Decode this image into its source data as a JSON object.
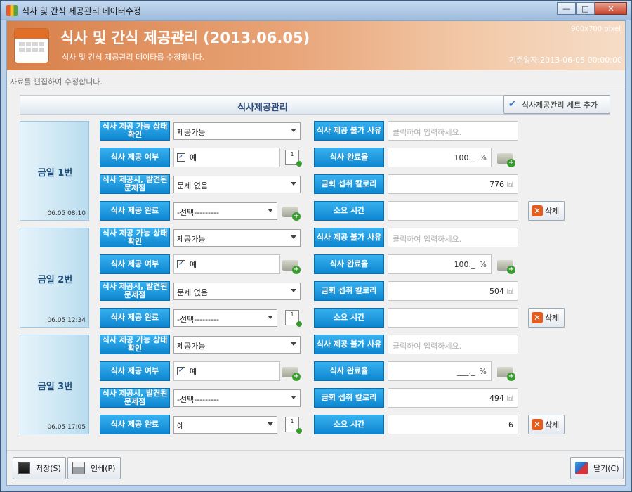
{
  "window": {
    "title": "식사 및 간식 제공관리 데이터수정",
    "controls": [
      "—",
      "□",
      "✕"
    ]
  },
  "header": {
    "title": "식사 및 간식 제공관리 (2013.06.05)",
    "subtitle": "식사 및 간식 제공관리 데이타를 수정합니다.",
    "size_tag": "900x700 pixel",
    "base_date": "기준일자:2013-06-05 00:00:00"
  },
  "hint": "자료를 편집하여 수정합니다.",
  "section": {
    "title": "식사제공관리",
    "add_set_label": "식사제공관리 세트 추가"
  },
  "labels": {
    "status_check": "식사 제공 가능 상태 확인",
    "meal_yn": "식사 제공 여부",
    "issues": "식사 제공시, 발견된 문제점",
    "complete": "식사 제공 완료",
    "unavailable_reason": "식사 제공 불가 사유",
    "completion_rate": "식사 완료율",
    "calories": "금회 섭취 칼로리",
    "duration": "소요 시간",
    "delete": "삭제",
    "pct_unit": "%",
    "kcal_unit": "㎉",
    "reason_placeholder": "클릭하여 입력하세요.",
    "page_one": "1"
  },
  "groups": [
    {
      "name": "금일 1번",
      "time": "06.05 08:10",
      "status": "제공가능",
      "meal_checked": true,
      "meal_value": "예",
      "issue": "문제 없음",
      "complete": "-선택---------",
      "rate": "100._",
      "calories": "776",
      "duration": ""
    },
    {
      "name": "금일 2번",
      "time": "06.05 12:34",
      "status": "제공가능",
      "meal_checked": true,
      "meal_value": "예",
      "issue": "문제 없음",
      "complete": "-선택---------",
      "rate": "100._",
      "calories": "504",
      "duration": ""
    },
    {
      "name": "금일 3번",
      "time": "06.05 17:05",
      "status": "제공가능",
      "meal_checked": true,
      "meal_value": "예",
      "issue": "-선택---------",
      "complete": "예",
      "rate": "___._",
      "calories": "494",
      "duration": "6"
    }
  ],
  "footer": {
    "save": "저장(S)",
    "print": "인쇄(P)",
    "close": "닫기(C)"
  }
}
